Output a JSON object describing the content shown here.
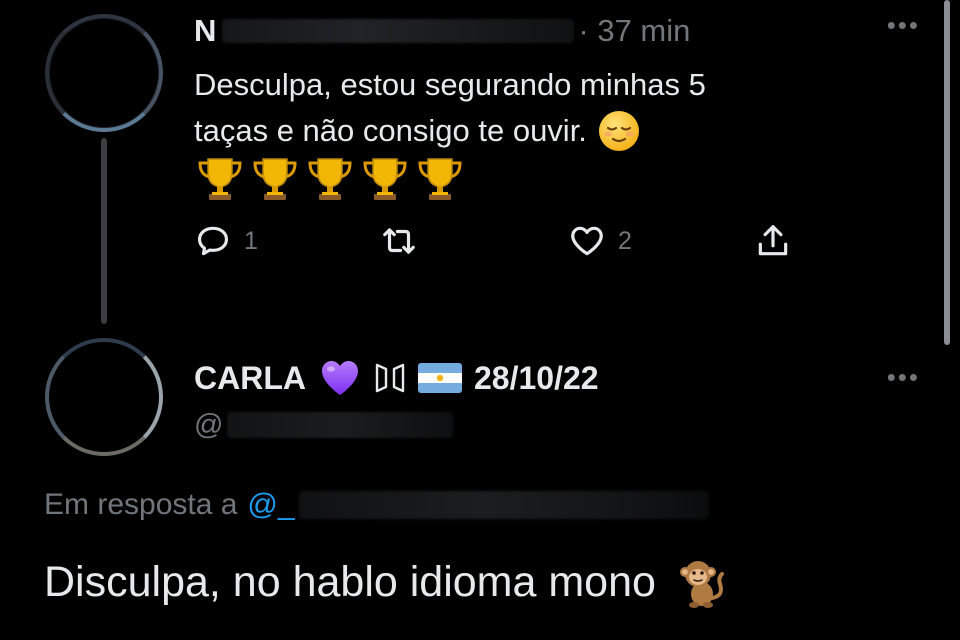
{
  "reply1": {
    "name_initial": "N",
    "time": "· 37 min",
    "text_line1": "Desculpa, estou segurando minhas 5",
    "text_line2": "taças e não consigo te ouvir.",
    "trophy_count_shown": 5,
    "actions": {
      "reply_count": "1",
      "retweet_count": "",
      "like_count": "2"
    }
  },
  "reply2": {
    "name": "CARLA",
    "date": "28/10/22",
    "handle_prefix": "@",
    "reply_to_label": "Em resposta a",
    "reply_to_handle_prefix": "@_",
    "text": "Disculpa, no hablo idioma mono"
  },
  "icons": {
    "reply": "speech-bubble-icon",
    "retweet": "retweet-arrows-icon",
    "like": "heart-outline-icon",
    "share": "share-upload-icon",
    "more": "more-dots-icon"
  },
  "colors": {
    "background": "#000000",
    "text": "#e7e9ea",
    "muted": "#71767b",
    "link": "#1d9bf0",
    "thread_line": "#3a3d42"
  }
}
